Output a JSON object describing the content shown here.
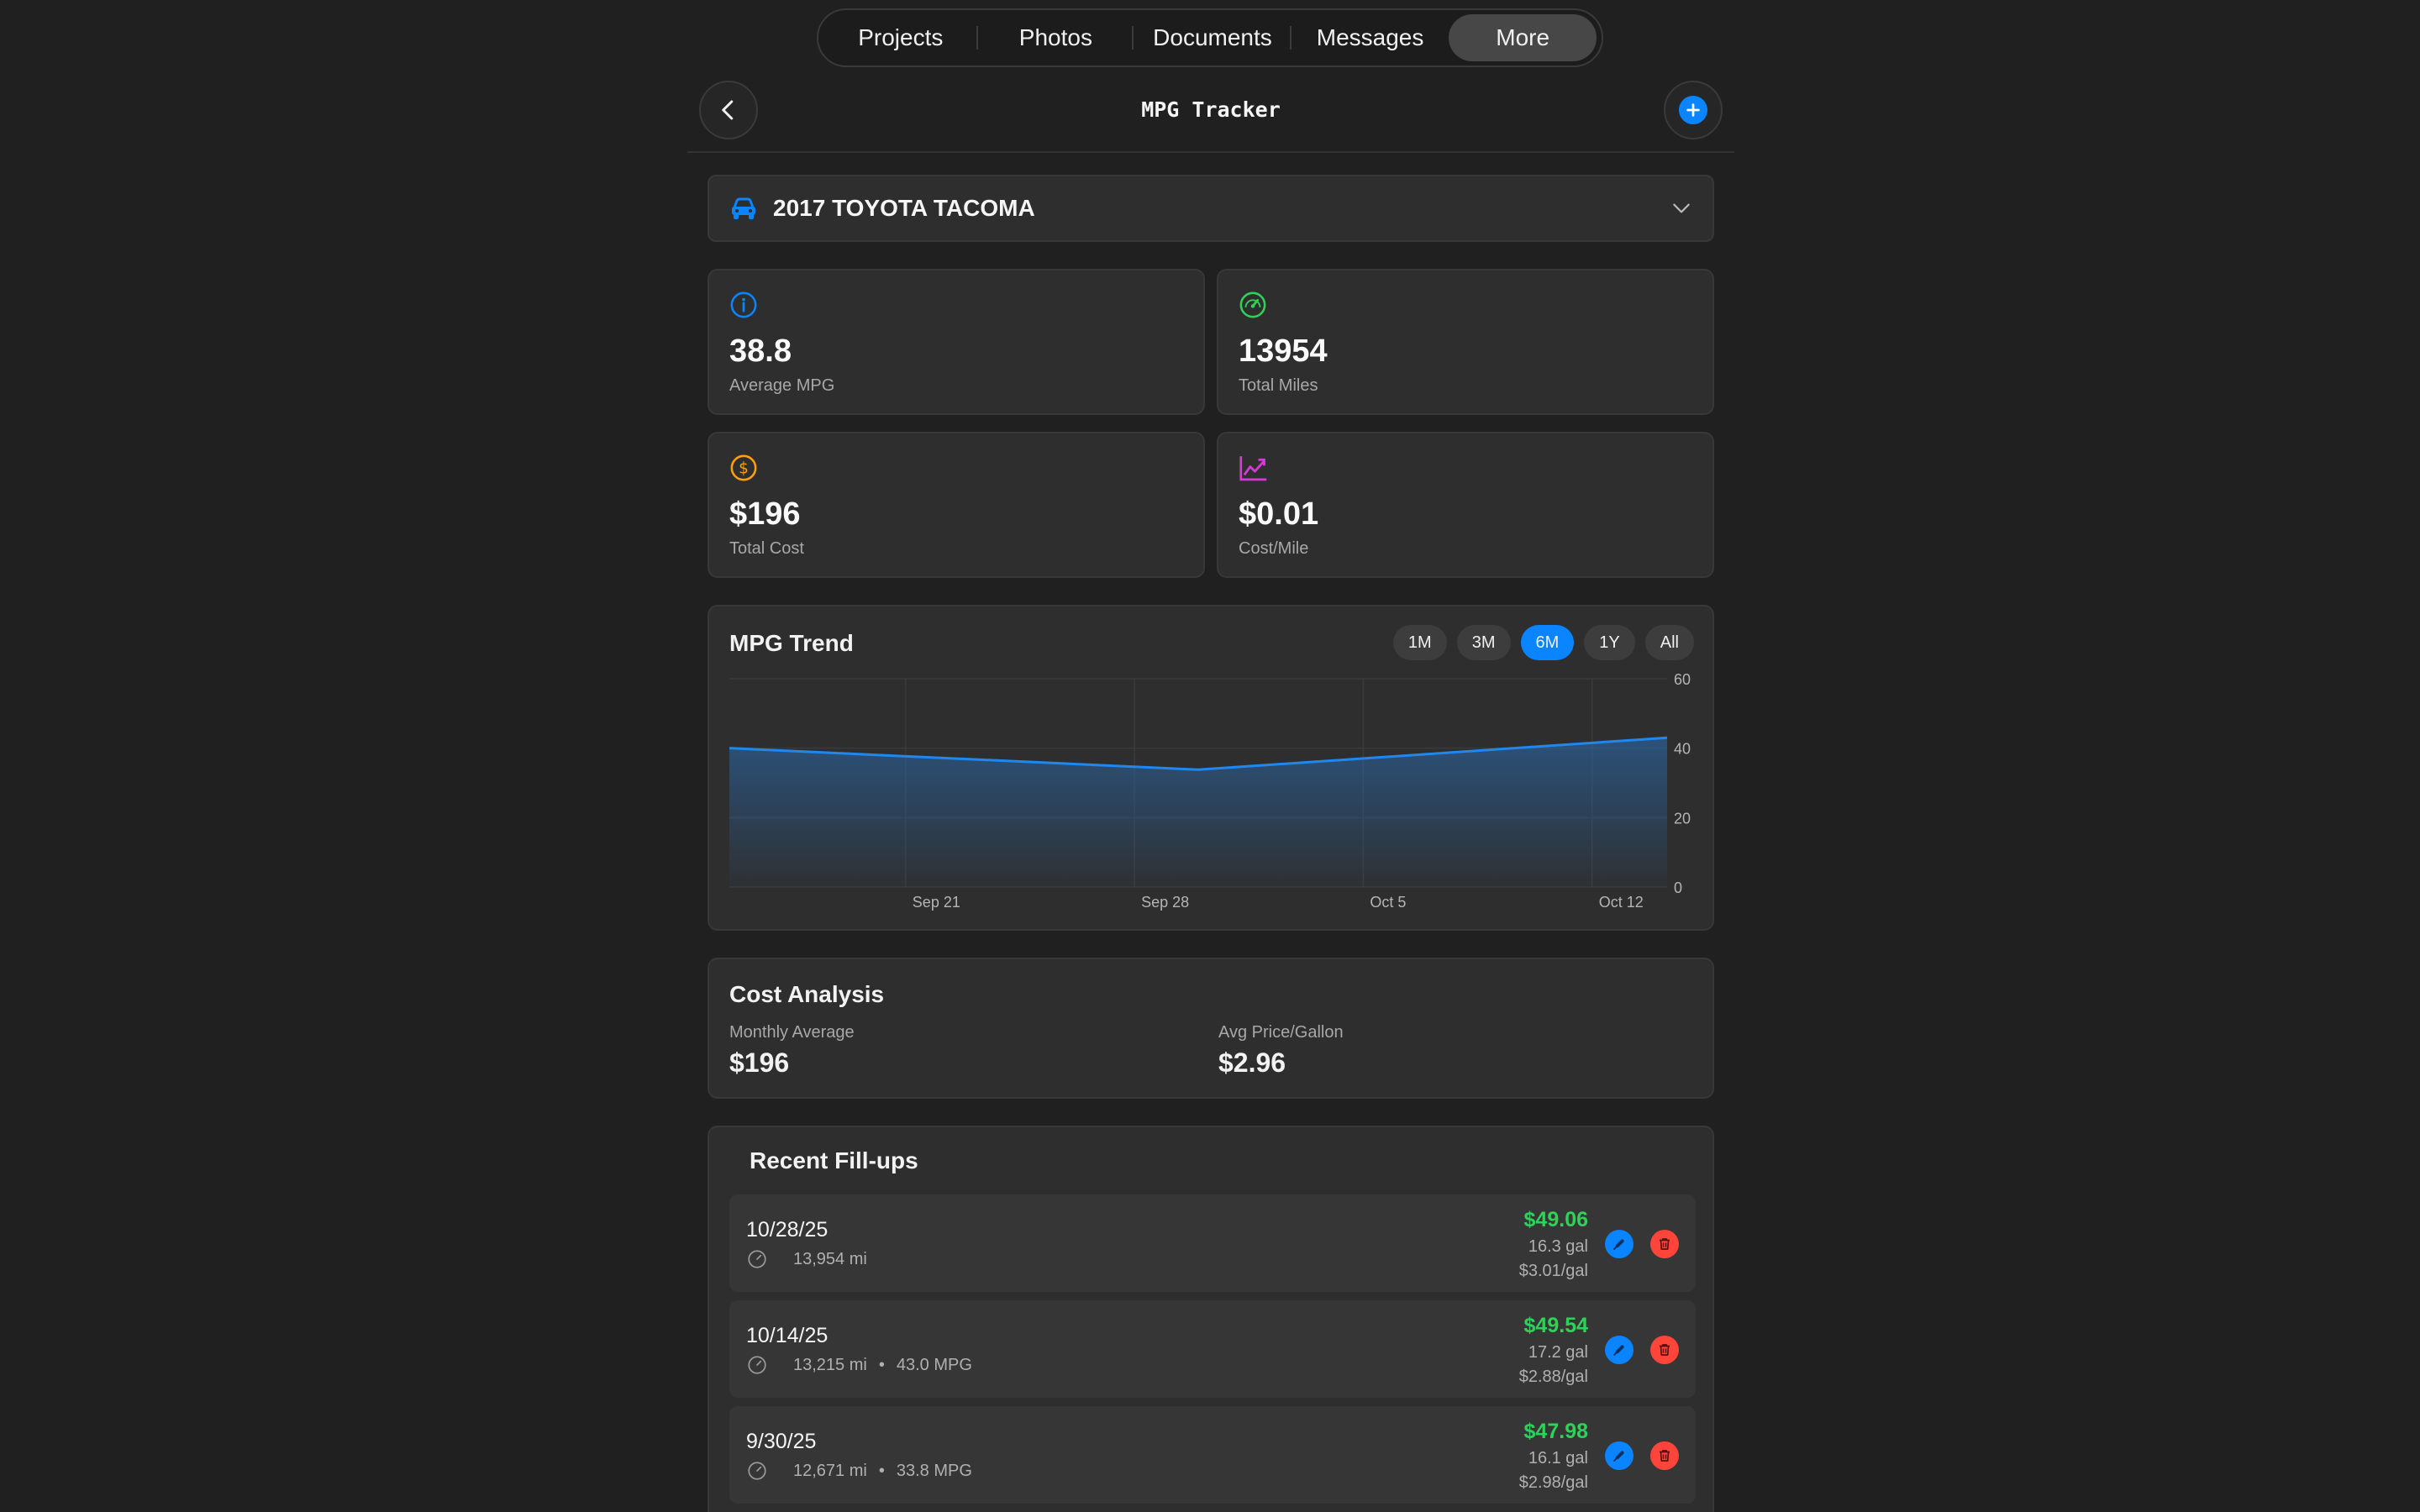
{
  "nav": {
    "tabs": [
      "Projects",
      "Photos",
      "Documents",
      "Messages",
      "More"
    ],
    "active": "More"
  },
  "header": {
    "title": "MPG Tracker"
  },
  "vehicle": {
    "name": "2017 TOYOTA TACOMA"
  },
  "stats": {
    "avg_mpg": {
      "value": "38.8",
      "label": "Average MPG"
    },
    "total_miles": {
      "value": "13954",
      "label": "Total Miles"
    },
    "total_cost": {
      "value": "$196",
      "label": "Total Cost"
    },
    "cost_mile": {
      "value": "$0.01",
      "label": "Cost/Mile"
    }
  },
  "trend": {
    "title": "MPG Trend",
    "ranges": [
      "1M",
      "3M",
      "6M",
      "1Y",
      "All"
    ],
    "active_range": "6M"
  },
  "chart_data": {
    "type": "area",
    "x": [
      "Sep 16",
      "Sep 30",
      "Oct 14"
    ],
    "x_tick_labels": [
      "Sep 21",
      "Sep 28",
      "Oct 5",
      "Oct 12"
    ],
    "values": [
      40.0,
      33.8,
      43.0
    ],
    "ylim": [
      0,
      60
    ],
    "y_ticks": [
      0,
      20,
      40,
      60
    ],
    "grid": true
  },
  "cost": {
    "title": "Cost Analysis",
    "monthly_avg": {
      "label": "Monthly Average",
      "value": "$196"
    },
    "avg_price": {
      "label": "Avg Price/Gallon",
      "value": "$2.96"
    }
  },
  "recent": {
    "title": "Recent Fill-ups",
    "rows": [
      {
        "date": "10/28/25",
        "miles": "13,954 mi",
        "mpg": "",
        "price": "$49.06",
        "gal": "16.3 gal",
        "ppg": "$3.01/gal"
      },
      {
        "date": "10/14/25",
        "miles": "13,215 mi",
        "mpg": "43.0 MPG",
        "price": "$49.54",
        "gal": "17.2 gal",
        "ppg": "$2.88/gal"
      },
      {
        "date": "9/30/25",
        "miles": "12,671 mi",
        "mpg": "33.8 MPG",
        "price": "$47.98",
        "gal": "16.1 gal",
        "ppg": "$2.98/gal"
      }
    ]
  },
  "colors": {
    "accent": "#0a84ff",
    "success": "#30d158",
    "danger": "#ff453a",
    "mpg_icon": "#0a84ff",
    "miles_icon": "#30d158",
    "cost_icon": "#ff9f0a",
    "costmile_icon": "#d63ad6"
  },
  "icons": {
    "vehicle": "car-icon",
    "avg_mpg": "info-gauge-icon",
    "total_miles": "speedometer-icon",
    "total_cost": "dollar-icon",
    "cost_mile": "trend-up-icon"
  }
}
